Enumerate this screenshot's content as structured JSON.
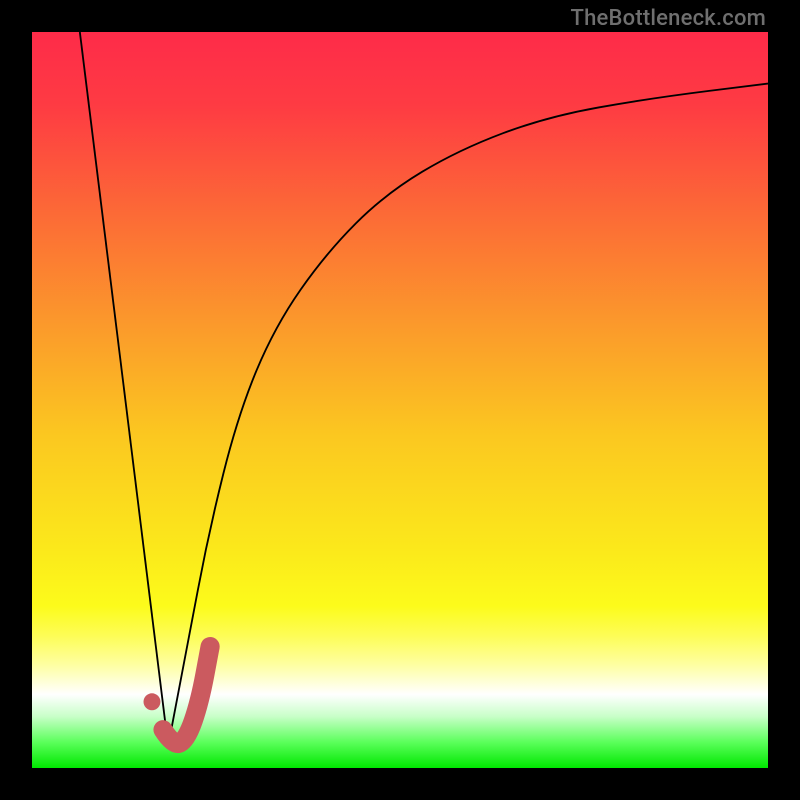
{
  "watermark": "TheBottleneck.com",
  "colors": {
    "frame": "#000000",
    "curve": "#000000",
    "marker_fill": "#cb5a5f",
    "marker_dot": "#cb5a5f",
    "gradient_stops": [
      {
        "offset": 0.0,
        "color": "#fe2b49"
      },
      {
        "offset": 0.1,
        "color": "#fe3b43"
      },
      {
        "offset": 0.25,
        "color": "#fc6b36"
      },
      {
        "offset": 0.4,
        "color": "#fb9a2b"
      },
      {
        "offset": 0.55,
        "color": "#fbc820"
      },
      {
        "offset": 0.7,
        "color": "#fbe81b"
      },
      {
        "offset": 0.78,
        "color": "#fcfb1b"
      },
      {
        "offset": 0.82,
        "color": "#fdfd56"
      },
      {
        "offset": 0.86,
        "color": "#feffa2"
      },
      {
        "offset": 0.9,
        "color": "#ffffff"
      },
      {
        "offset": 0.93,
        "color": "#c8ffc8"
      },
      {
        "offset": 0.965,
        "color": "#5bff5b"
      },
      {
        "offset": 1.0,
        "color": "#00e800"
      }
    ]
  },
  "chart_data": {
    "type": "line",
    "title": "",
    "xlabel": "",
    "ylabel": "",
    "xlim": [
      0,
      100
    ],
    "ylim": [
      0,
      100
    ],
    "grid": false,
    "series": [
      {
        "name": "left-slope",
        "x": [
          6.5,
          18.5
        ],
        "values": [
          100,
          3
        ]
      },
      {
        "name": "right-curve",
        "x": [
          18.5,
          21,
          24,
          28,
          33,
          40,
          48,
          58,
          70,
          84,
          100
        ],
        "values": [
          3,
          16,
          32,
          48,
          60,
          70,
          78,
          84,
          88.5,
          91,
          93
        ]
      }
    ],
    "annotations": {
      "dot": {
        "x": 16.3,
        "y": 9
      },
      "j_path": [
        {
          "x": 17.8,
          "y": 5.2
        },
        {
          "x": 19.2,
          "y": 3.0
        },
        {
          "x": 21.0,
          "y": 3.8
        },
        {
          "x": 22.8,
          "y": 9.0
        },
        {
          "x": 24.2,
          "y": 16.5
        }
      ]
    }
  }
}
